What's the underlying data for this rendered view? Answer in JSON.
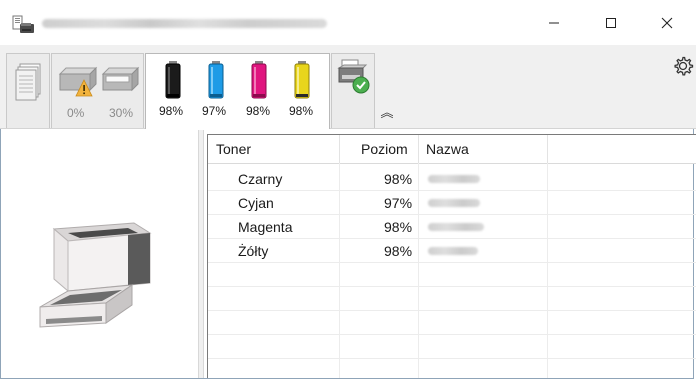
{
  "window": {
    "title": "",
    "controls": {
      "minimize": "—",
      "maximize": "☐",
      "close": "✕"
    }
  },
  "tabs": {
    "paper": {
      "level_1": "0%",
      "level_2": "30%"
    },
    "toner": [
      {
        "color": "#1b1b1b",
        "level": "98%"
      },
      {
        "color": "#1e9be6",
        "level": "97%"
      },
      {
        "color": "#e0157f",
        "level": "98%"
      },
      {
        "color": "#e8d51c",
        "level": "98%"
      }
    ],
    "collapse_glyph": "︽",
    "settings_icon": "gear-icon"
  },
  "table": {
    "headers": {
      "toner": "Toner",
      "level": "Poziom",
      "name": "Nazwa"
    },
    "rows": [
      {
        "toner": "Czarny",
        "level": "98%"
      },
      {
        "toner": "Cyjan",
        "level": "97%"
      },
      {
        "toner": "Magenta",
        "level": "98%"
      },
      {
        "toner": "Żółty",
        "level": "98%"
      }
    ]
  },
  "colors": {
    "warning": "#f2b33d",
    "status_ok": "#4caf50"
  }
}
